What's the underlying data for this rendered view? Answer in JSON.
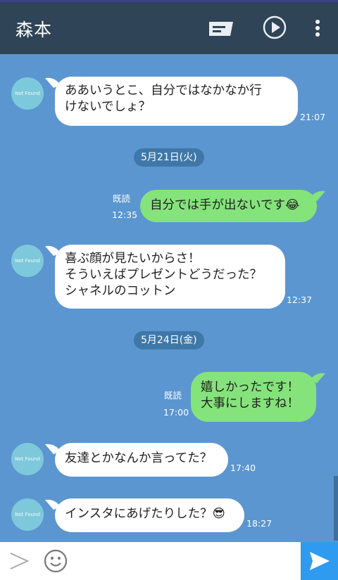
{
  "header": {
    "title": "森本"
  },
  "messages": [
    {
      "text": "ああいうとこ、自分ではなかなか行\nけないでしょ？",
      "time": "21:07"
    },
    {
      "text": "自分では手が出ないです😂",
      "time": "12:35",
      "read": "既読"
    },
    {
      "text": "喜ぶ顔が見たいからさ！\nそういえばプレゼントどうだった？\nシャネルのコットン",
      "time": "12:37"
    },
    {
      "text": "嬉しかったです！\n大事にしますね！",
      "time": "17:00",
      "read": "既読"
    },
    {
      "text": "友達とかなんか言ってた？",
      "time": "17:40"
    },
    {
      "text": "インスタにあげたりした？😎",
      "time": "18:27"
    }
  ],
  "dates": [
    "5月21日(火)",
    "5月24日(金)"
  ],
  "avatar_text": "Not Found",
  "colors": {
    "header_bg": "#2f4456",
    "chat_bg": "#5b96d0",
    "incoming_bubble": "#ffffff",
    "outgoing_bubble": "#85e37b",
    "date_pill": "#3f78a8",
    "send_button": "#2e9bf0"
  },
  "icons": [
    "message-icon",
    "play-icon",
    "more-vert-icon",
    "expand-icon",
    "emoji-icon",
    "send-icon"
  ]
}
